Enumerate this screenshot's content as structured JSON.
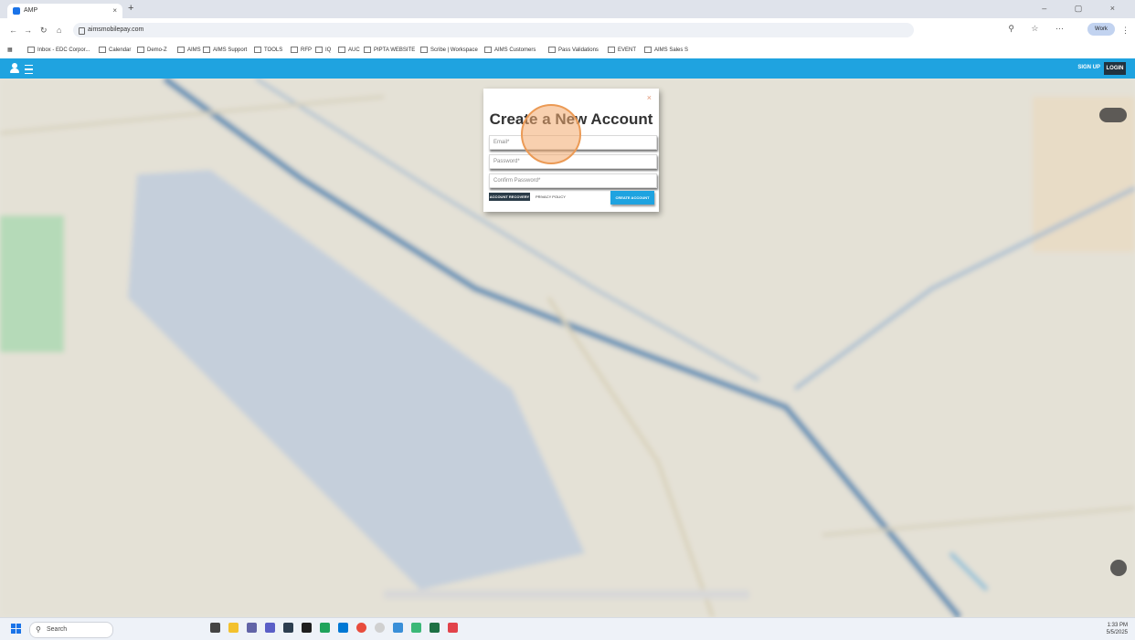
{
  "browser": {
    "tab_title": "AMP",
    "tab_close": "×",
    "new_tab": "+",
    "url": "aimsmobilepay.com",
    "profile_label": "Work",
    "window_controls": "– ▢ ×",
    "bookmarks": [
      "Inbox - EDC Corpor...",
      "Calendar",
      "Demo-Z",
      "AIMS",
      "AIMS Support",
      "TOOLS",
      "RFP",
      "IQ",
      "AUC",
      "PIPTA WEBSITE",
      "Scribe | Workspace",
      "AIMS Customers",
      "Pass Validations",
      "EVENT",
      "AIMS Sales S"
    ]
  },
  "app_header": {
    "signup_label": "SIGN UP",
    "login_label": "LOGIN",
    "accent_color": "#1fa3e0"
  },
  "modal": {
    "close_label": "×",
    "title": "Create a New Account",
    "email_placeholder": "Email*",
    "password_placeholder": "Password*",
    "confirm_placeholder": "Confirm Password*",
    "recovery_label": "ACCOUNT RECOVERY",
    "privacy_label": "PRIVACY POLICY",
    "create_label": "CREATE ACCOUNT"
  },
  "taskbar": {
    "search_label": "Search",
    "time": "1:33 PM",
    "date": "5/5/2025"
  }
}
